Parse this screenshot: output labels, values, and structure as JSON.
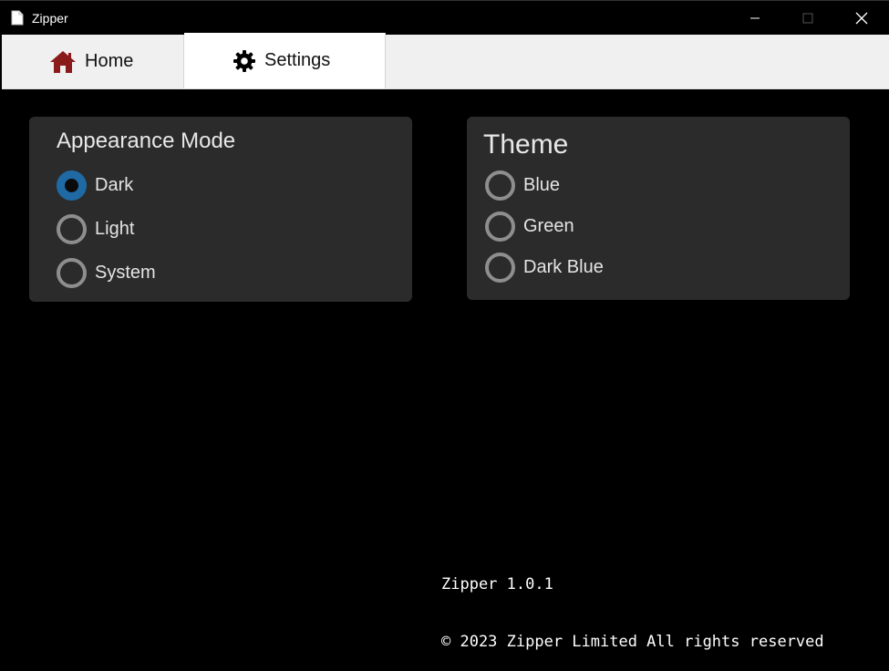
{
  "window": {
    "title": "Zipper"
  },
  "tabs": [
    {
      "label": "Home",
      "icon": "home-icon",
      "icon_color": "#8b1a1a"
    },
    {
      "label": "Settings",
      "icon": "gear-icon",
      "icon_color": "#000000"
    }
  ],
  "appearance": {
    "title": "Appearance Mode",
    "options": [
      "Dark",
      "Light",
      "System"
    ],
    "selected": "Dark"
  },
  "theme": {
    "title": "Theme",
    "options": [
      "Blue",
      "Green",
      "Dark Blue"
    ],
    "selected": ""
  },
  "footer": {
    "version": "Zipper 1.0.1",
    "copyright": "© 2023 Zipper Limited All rights reserved"
  },
  "colors": {
    "background": "#000000",
    "panel": "#2b2b2b",
    "accent": "#1f6aa5",
    "radio_border": "#8e8e8e"
  }
}
